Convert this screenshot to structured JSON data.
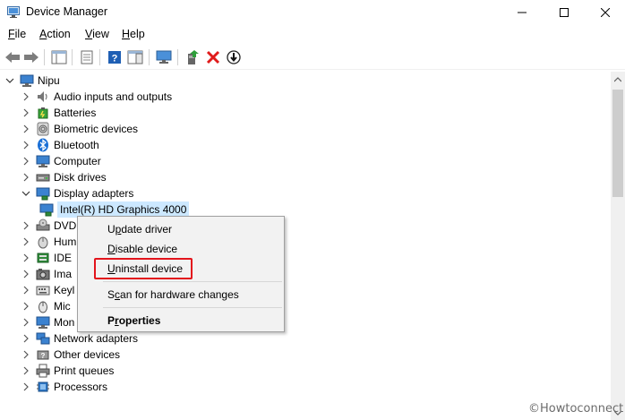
{
  "window": {
    "title": "Device Manager"
  },
  "menu": [
    {
      "label": "File",
      "mnemonic": "F",
      "rest": "ile"
    },
    {
      "label": "Action",
      "mnemonic": "A",
      "rest": "ction"
    },
    {
      "label": "View",
      "mnemonic": "V",
      "rest": "iew"
    },
    {
      "label": "Help",
      "mnemonic": "H",
      "rest": "elp"
    }
  ],
  "toolbar": {
    "icons": [
      "back-arrow-icon",
      "forward-arrow-icon",
      "show-hide-console-tree-icon",
      "properties-sheet-icon",
      "help-icon",
      "action-pane-icon",
      "monitor-scan-icon",
      "update-driver-icon",
      "uninstall-x-icon",
      "download-arrow-icon"
    ]
  },
  "tree": {
    "root": "Nipu",
    "items": [
      {
        "label": "Audio inputs and outputs",
        "icon": "speaker-icon",
        "expanded": false
      },
      {
        "label": "Batteries",
        "icon": "battery-icon",
        "expanded": false
      },
      {
        "label": "Biometric devices",
        "icon": "fingerprint-icon",
        "expanded": false
      },
      {
        "label": "Bluetooth",
        "icon": "bluetooth-icon",
        "expanded": false
      },
      {
        "label": "Computer",
        "icon": "computer-icon",
        "expanded": false
      },
      {
        "label": "Disk drives",
        "icon": "disk-drive-icon",
        "expanded": false
      },
      {
        "label": "Display adapters",
        "icon": "display-adapter-icon",
        "expanded": true
      },
      {
        "label": "Intel(R) HD Graphics 4000",
        "icon": "display-adapter-icon",
        "child": true,
        "selected": true
      },
      {
        "label": "DVD",
        "icon": "dvd-icon",
        "expanded": false
      },
      {
        "label": "Hum",
        "icon": "hid-icon",
        "expanded": false
      },
      {
        "label": "IDE",
        "icon": "ide-controller-icon",
        "expanded": false
      },
      {
        "label": "Ima",
        "icon": "camera-icon",
        "expanded": false
      },
      {
        "label": "Keyl",
        "icon": "keyboard-icon",
        "expanded": false
      },
      {
        "label": "Mic",
        "icon": "mouse-icon",
        "expanded": false
      },
      {
        "label": "Mon",
        "icon": "monitor-icon",
        "expanded": false
      },
      {
        "label": "Network adapters",
        "icon": "network-adapter-icon",
        "expanded": false
      },
      {
        "label": "Other devices",
        "icon": "other-devices-icon",
        "expanded": false
      },
      {
        "label": "Print queues",
        "icon": "printer-icon",
        "expanded": false
      },
      {
        "label": "Processors",
        "icon": "processor-icon",
        "expanded": false
      }
    ]
  },
  "context_menu": {
    "items": [
      {
        "label": "Update driver",
        "mnemonic": "p"
      },
      {
        "label": "Disable device",
        "mnemonic": "D"
      },
      {
        "label": "Uninstall device",
        "mnemonic": "U",
        "highlighted": true
      },
      {
        "label": "Scan for hardware changes",
        "mnemonic": "c"
      },
      {
        "label": "Properties",
        "mnemonic": "r",
        "bold": true
      }
    ]
  },
  "watermark": "©Howtoconnect",
  "colors": {
    "selection": "#cce8ff",
    "highlight_border": "#e3141c"
  }
}
